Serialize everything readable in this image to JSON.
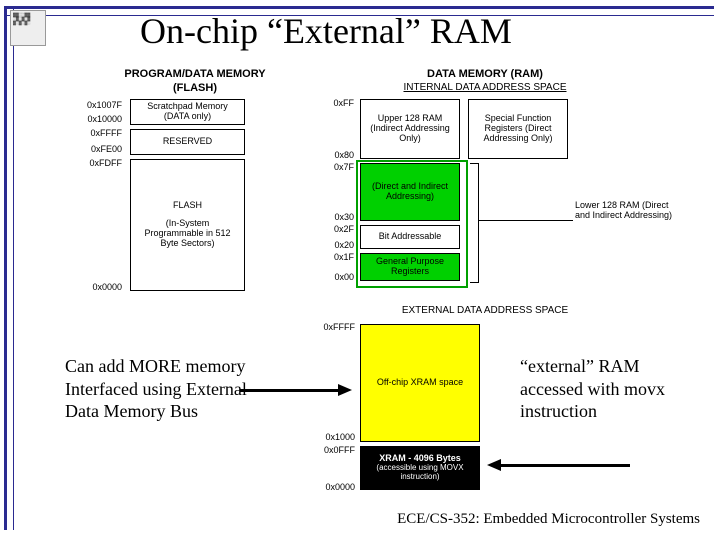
{
  "title": "On-chip “External” RAM",
  "flash": {
    "header1": "PROGRAM/DATA MEMORY",
    "header2": "(FLASH)",
    "addr": {
      "a1007F": "0x1007F",
      "a10000": "0x10000",
      "aFFFF": "0xFFFF",
      "aFE00": "0xFE00",
      "aFDFF": "0xFDFF",
      "a0000": "0x0000"
    },
    "scratchpad1": "Scratchpad Memory",
    "scratchpad2": "(DATA only)",
    "reserved": "RESERVED",
    "main1": "FLASH",
    "main2": "(In-System Programmable in 512 Byte Sectors)"
  },
  "ram": {
    "header1": "DATA MEMORY (RAM)",
    "header2": "INTERNAL DATA  ADDRESS SPACE",
    "addr": {
      "aFF": "0xFF",
      "a80": "0x80",
      "a7F": "0x7F",
      "a30": "0x30",
      "a2F": "0x2F",
      "a20": "0x20",
      "a1F": "0x1F",
      "a00": "0x00"
    },
    "upper": "Upper 128 RAM (Indirect Addressing Only)",
    "sfr": "Special Function Registers (Direct Addressing Only)",
    "mid": "(Direct and Indirect Addressing)",
    "bit": "Bit Addressable",
    "gpr": "General Purpose Registers",
    "lower": "Lower 128 RAM (Direct and Indirect Addressing)"
  },
  "ext": {
    "header": "EXTERNAL DATA ADDRESS SPACE",
    "addr": {
      "aFFFF": "0xFFFF",
      "a1000": "0x1000",
      "a0FFF": "0x0FFF",
      "a0000": "0x0000"
    },
    "offchip": "Off-chip XRAM space",
    "xram1": "XRAM - 4096 Bytes",
    "xram2": "(accessible using MOVX instruction)"
  },
  "note_left": "Can add MORE memory\nInterfaced using External Data Memory Bus",
  "note_right": "“external” RAM accessed with movx  instruction",
  "footer": "ECE/CS-352: Embedded Microcontroller Systems"
}
